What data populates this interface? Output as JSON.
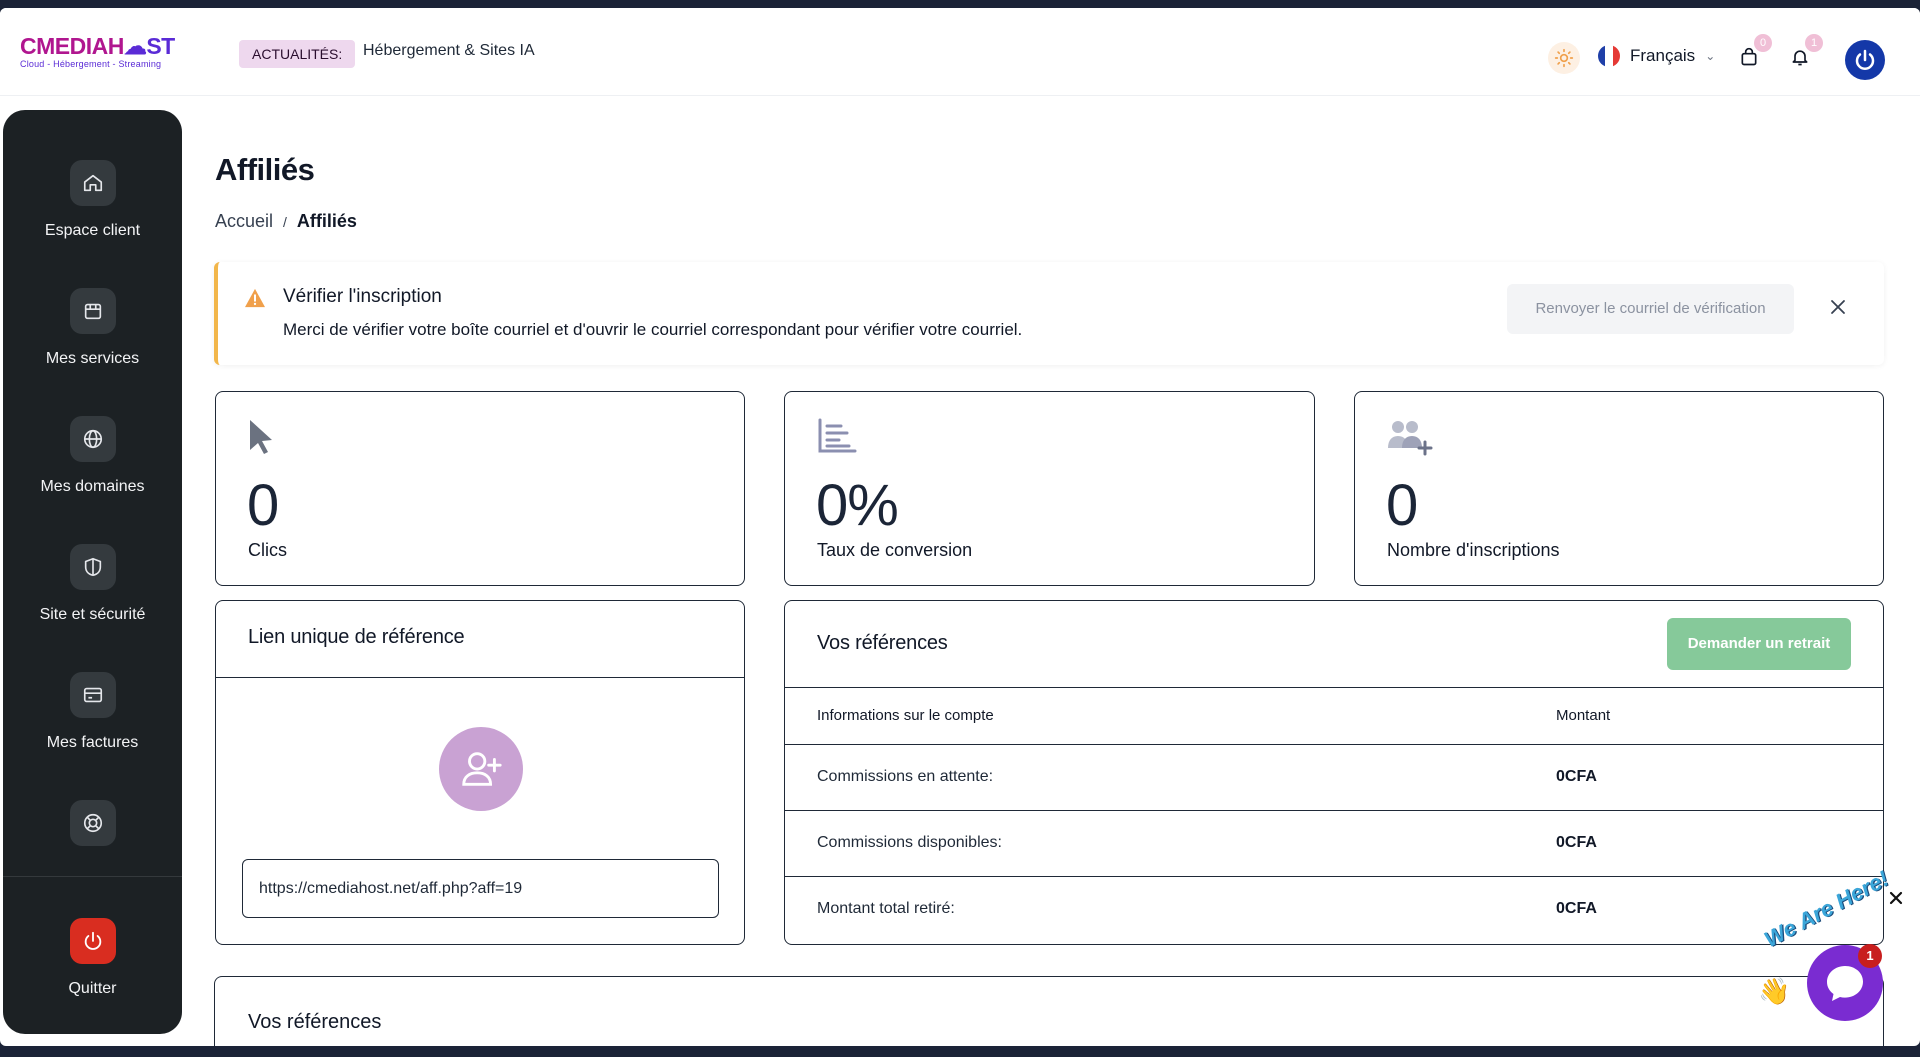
{
  "header": {
    "logo": {
      "brand_prefix": "CMEDIAH",
      "brand_suffix": "ST",
      "tagline": "Cloud - Hébergement - Streaming"
    },
    "news_label": "ACTUALITÉS:",
    "news_text": "Hébergement & Sites IA",
    "language": "Français",
    "cart_count": "0",
    "notification_count": "1"
  },
  "sidebar": {
    "items": [
      {
        "label": "Espace client",
        "icon": "home-icon"
      },
      {
        "label": "Mes services",
        "icon": "box-icon"
      },
      {
        "label": "Mes domaines",
        "icon": "globe-icon"
      },
      {
        "label": "Site et sécurité",
        "icon": "shield-icon"
      },
      {
        "label": "Mes factures",
        "icon": "credit-card-icon"
      },
      {
        "label": "",
        "icon": "lifebuoy-icon"
      }
    ],
    "quit_label": "Quitter"
  },
  "page": {
    "title": "Affiliés",
    "breadcrumb": {
      "home": "Accueil",
      "separator": "/",
      "current": "Affiliés"
    }
  },
  "alert": {
    "title": "Vérifier l'inscription",
    "message": "Merci de vérifier votre boîte courriel et d'ouvrir le courriel correspondant pour vérifier votre courriel.",
    "resend_label": "Renvoyer le courriel de vérification"
  },
  "stats": [
    {
      "value": "0",
      "label": "Clics",
      "icon": "cursor-icon"
    },
    {
      "value": "0%",
      "label": "Taux de conversion",
      "icon": "bar-chart-icon"
    },
    {
      "value": "0",
      "label": "Nombre d'inscriptions",
      "icon": "users-plus-icon"
    }
  ],
  "referral_link": {
    "title": "Lien unique de référence",
    "url": "https://cmediahost.net/aff.php?aff=19"
  },
  "references": {
    "title": "Vos références",
    "withdraw_label": "Demander un retrait",
    "headers": [
      "Informations sur le compte",
      "Montant"
    ],
    "rows": [
      {
        "label": "Commissions en attente:",
        "amount": "0CFA"
      },
      {
        "label": "Commissions disponibles:",
        "amount": "0CFA"
      },
      {
        "label": "Montant total retiré:",
        "amount": "0CFA"
      }
    ]
  },
  "bottom_section": {
    "title": "Vos références"
  },
  "chat": {
    "tagline": "We Are Here!",
    "badge": "1"
  },
  "colors": {
    "accent_purple": "#7a2cd1",
    "sidebar_bg": "#1c2124",
    "quit_red": "#d92d20",
    "withdraw_green": "#86c99a",
    "alert_warning": "#f2b64a",
    "power_blue": "#1438a8"
  }
}
